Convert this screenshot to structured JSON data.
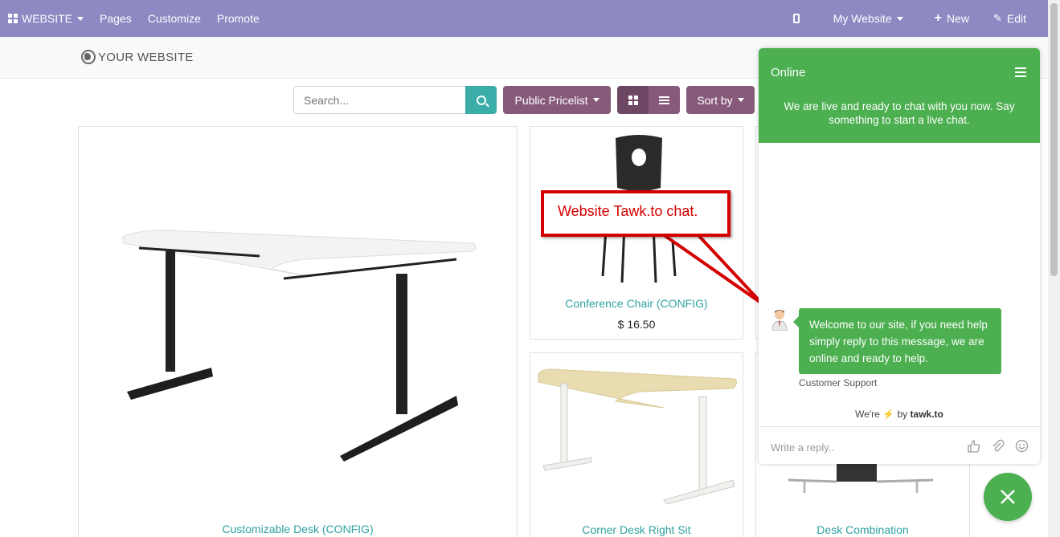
{
  "topbar": {
    "website_menu": "WEBSITE",
    "pages": "Pages",
    "customize": "Customize",
    "promote": "Promote",
    "my_website": "My Website",
    "new": "New",
    "edit": "Edit",
    "bg_color": "#8c89c3"
  },
  "site": {
    "logo_text": "YOUR WEBSITE"
  },
  "toolbar": {
    "search_placeholder": "Search...",
    "pricelist": "Public Pricelist",
    "sort_by": "Sort by"
  },
  "products": [
    {
      "name": "Customizable Desk (CONFIG)"
    },
    {
      "name": "Conference Chair (CONFIG)",
      "price": "$ 16.50"
    },
    {
      "name": "Corner Desk Right Sit"
    },
    {
      "name": "Desk Combination"
    }
  ],
  "annotation": {
    "text": "Website Tawk.to chat."
  },
  "chat": {
    "status": "Online",
    "intro": "We are live and ready to chat with you now. Say something to start a live chat.",
    "message": "Welcome to our site, if you need help simply reply to this message, we are online and ready to help.",
    "sender": "Customer Support",
    "brand_prefix": "We're",
    "brand_by": "by",
    "brand_name": "tawk.to",
    "reply_placeholder": "Write a reply..",
    "accent_color": "#4caf50"
  }
}
